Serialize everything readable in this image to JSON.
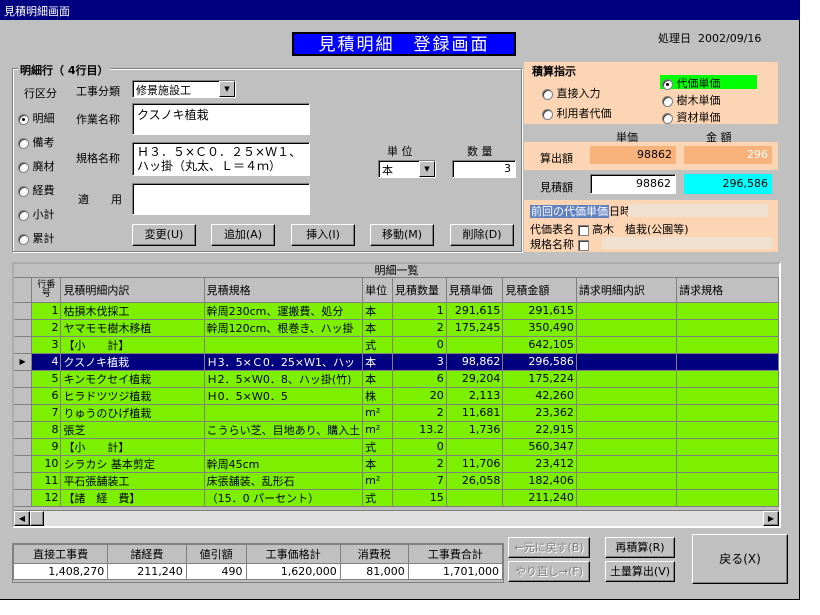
{
  "window": {
    "title": "見積明細画面"
  },
  "header": {
    "banner": "見積明細　登録画面",
    "date_label": "処理日",
    "date_value": "2002/09/16"
  },
  "detail": {
    "group_title": "明細行（ 4行目）",
    "row_type_label": "行区分",
    "row_types": [
      "明細",
      "備考",
      "廃材",
      "経費",
      "小計",
      "累計"
    ],
    "row_type_selected": "明細",
    "work_class_label": "工事分類",
    "work_class_value": "修景施設工",
    "work_name_label": "作業名称",
    "work_name_value": "クスノキ植栽",
    "spec_label": "規格名称",
    "spec_value_1": "Ｈ３．５×Ｃ０．２５×Ｗ１、",
    "spec_value_2": "ハッ掛（丸太、Ｌ＝４ｍ）",
    "apply_label": "適　　用",
    "apply_value": "",
    "unit_label": "単 位",
    "unit_value": "本",
    "qty_label": "数 量",
    "qty_value": "3",
    "buttons": {
      "change": "変更(U)",
      "add": "追加(A)",
      "insert": "挿入(I)",
      "move": "移動(M)",
      "delete": "削除(D)"
    }
  },
  "pricing": {
    "title": "積算指示",
    "options": [
      "直接入力",
      "利用者代価",
      "代価単価",
      "樹木単価",
      "資材単価"
    ],
    "selected": "代価単価",
    "col_unit": "単価",
    "col_amount": "金 額",
    "calc_label": "算出額",
    "calc_unit": "98862",
    "calc_amount": "296",
    "est_label": "見積額",
    "est_unit": "98862",
    "est_amount": "296,586",
    "prev_label": "前回の代価単価",
    "prev_suffix": "日時:",
    "price_table_label": "代価表名",
    "price_table_value": "高木　植栽(公園等)",
    "spec_name_label": "規格名称"
  },
  "grid": {
    "title": "明細一覧",
    "headers": [
      "行番号",
      "見積明細内訳",
      "見積規格",
      "単位",
      "見積数量",
      "見積単価",
      "見積金額",
      "請求明細内訳",
      "請求規格"
    ],
    "selected_row": 3,
    "rows": [
      [
        "1",
        "枯損木伐採工",
        "幹周230cm、運搬費、処分",
        "本",
        "1",
        "291,615",
        "291,615"
      ],
      [
        "2",
        "ヤマモモ樹木移植",
        "幹周120cm、根巻き、ハッ掛",
        "本",
        "2",
        "175,245",
        "350,490"
      ],
      [
        "3",
        "【小　　計】",
        "",
        "式",
        "0",
        "",
        "642,105"
      ],
      [
        "4",
        "クスノキ植栽",
        "Ｈ3．5×Ｃ0．25×Ｗ1、ハッ",
        "本",
        "3",
        "98,862",
        "296,586"
      ],
      [
        "5",
        "キンモクセイ植栽",
        "Ｈ2．5×Ｗ0．8、ハッ掛(竹)",
        "本",
        "6",
        "29,204",
        "175,224"
      ],
      [
        "6",
        "ヒラドツツジ植栽",
        "Ｈ0．5×Ｗ0．5",
        "株",
        "20",
        "2,113",
        "42,260"
      ],
      [
        "7",
        "りゅうのひげ植栽",
        "",
        "m²",
        "2",
        "11,681",
        "23,362"
      ],
      [
        "8",
        "張芝",
        "こうらい芝、目地あり、購入土",
        "m²",
        "13.2",
        "1,736",
        "22,915"
      ],
      [
        "9",
        "【小　　計】",
        "",
        "式",
        "0",
        "",
        "560,347"
      ],
      [
        "10",
        "シラカシ 基本剪定",
        "幹周45cm",
        "本",
        "2",
        "11,706",
        "23,412"
      ],
      [
        "11",
        "平石張舗装工",
        "床張舗装、乱形石",
        "m²",
        "7",
        "26,058",
        "182,406"
      ],
      [
        "12",
        "【諸　経　費】",
        "（15．0 パーセント）",
        "式",
        "15",
        "",
        "211,240"
      ]
    ]
  },
  "summary": {
    "headers": [
      "直接工事費",
      "諸経費",
      "値引額",
      "工事価格計",
      "消費税",
      "工事費合計"
    ],
    "values": [
      "1,408,270",
      "211,240",
      "490",
      "1,620,000",
      "81,000",
      "1,701,000"
    ]
  },
  "footer_buttons": {
    "undo": "←元に戻す(B)",
    "redo": "やり直し→(F)",
    "reestimate": "再積算(R)",
    "earthwork": "土量算出(V)",
    "back": "戻る(X)"
  },
  "colors": {
    "row_green": "#7df000",
    "selected_row": "#000080",
    "banner": "#0000ff",
    "calc_bg": "#fcd5b4",
    "est_amount_bg": "#00ffff"
  }
}
